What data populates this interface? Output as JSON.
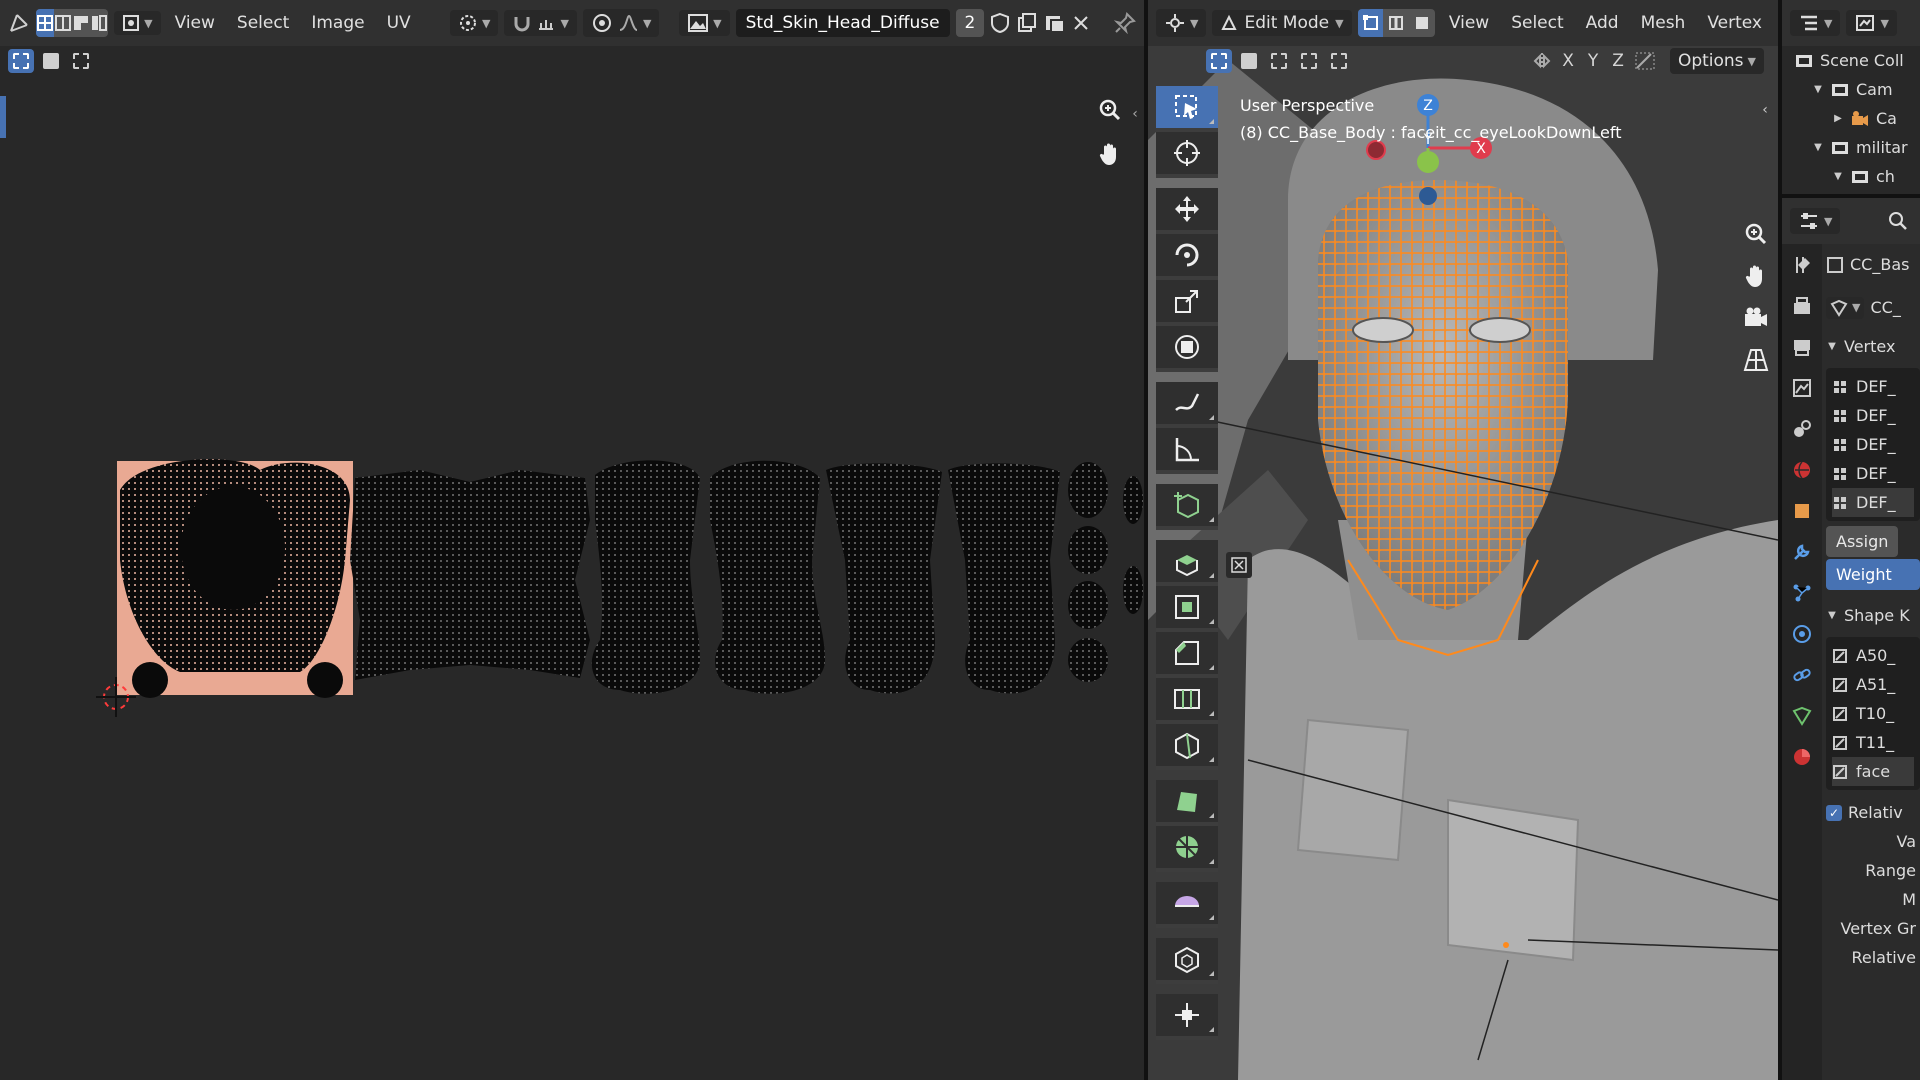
{
  "uv_editor": {
    "menus": [
      "View",
      "Select",
      "Image",
      "UV"
    ],
    "image_name": "Std_Skin_Head_Diffuse",
    "image_users": "2"
  },
  "viewport": {
    "mode": "Edit Mode",
    "menus": [
      "View",
      "Select",
      "Add",
      "Mesh",
      "Vertex"
    ],
    "axes": [
      "X",
      "Y",
      "Z"
    ],
    "options_label": "Options",
    "info_line1": "User Perspective",
    "info_line2": "(8) CC_Base_Body : faceit_cc_eyeLookDownLeft",
    "gizmo": {
      "z": "Z",
      "y": "Y",
      "x": "X"
    },
    "tools": [
      "select-box",
      "cursor",
      "move",
      "rotate",
      "scale",
      "transform",
      "annotate",
      "measure",
      "add-cube",
      "extrude",
      "inset",
      "bevel",
      "loop-cut",
      "knife",
      "poly-build",
      "spin",
      "smooth",
      "shrink-fatten",
      "shear"
    ]
  },
  "outliner": {
    "items": [
      {
        "label": "Scene Coll",
        "depth": 0,
        "expanded": null
      },
      {
        "label": "Cam",
        "depth": 1,
        "expanded": true
      },
      {
        "label": "Ca",
        "depth": 2,
        "expanded": false
      },
      {
        "label": "militar",
        "depth": 1,
        "expanded": true
      },
      {
        "label": "ch",
        "depth": 2,
        "expanded": true
      }
    ]
  },
  "properties": {
    "object_name": "CC_Bas",
    "mesh_name": "CC_",
    "vertex_groups_header": "Vertex",
    "vertex_groups": [
      "DEF_",
      "DEF_",
      "DEF_",
      "DEF_",
      "DEF_"
    ],
    "assign_label": "Assign",
    "weight_label": "Weight",
    "shape_keys_header": "Shape K",
    "shape_keys": [
      "A50_",
      "A51_",
      "T10_",
      "T11_",
      "face"
    ],
    "relative_label": "Relativ",
    "value_label": "Va",
    "range_label": "Range",
    "n_label": "M",
    "vertex_group_label": "Vertex Gr",
    "relative_to_label": "Relative"
  },
  "colors": {
    "accent": "#4772b3",
    "uv_image_bg": "#e9a993",
    "mesh_select": "#ff8a1c",
    "gizmo_x": "#e03c4d",
    "gizmo_y": "#8ac34a",
    "gizmo_z": "#3d82d6"
  }
}
